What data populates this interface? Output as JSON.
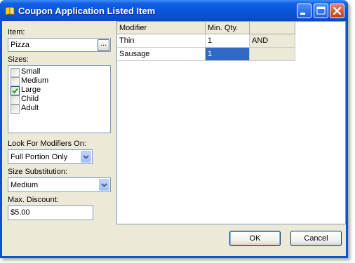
{
  "window": {
    "title": "Coupon Application Listed Item"
  },
  "titlebar_buttons": {
    "minimize": "minimize-icon",
    "maximize": "maximize-icon",
    "close": "close-icon"
  },
  "item": {
    "label": "Item:",
    "value": "Pizza",
    "browse_label": "..."
  },
  "sizes": {
    "label": "Sizes:",
    "items": [
      {
        "label": "Small",
        "checked": false
      },
      {
        "label": "Medium",
        "checked": false
      },
      {
        "label": "Large",
        "checked": true
      },
      {
        "label": "Child",
        "checked": false
      },
      {
        "label": "Adult",
        "checked": false
      }
    ]
  },
  "look_for_modifiers": {
    "label": "Look For Modifiers On:",
    "value": "Full Portion Only"
  },
  "size_substitution": {
    "label": "Size Substitution:",
    "value": "Medium"
  },
  "max_discount": {
    "label": "Max. Discount:",
    "value": "$5.00"
  },
  "grid": {
    "headers": [
      "Modifier",
      "Min. Qty.",
      ""
    ],
    "rows": [
      {
        "modifier": "Thin",
        "min_qty": "1",
        "logic": "AND"
      },
      {
        "modifier": "Sausage",
        "min_qty": "1",
        "logic": ""
      }
    ]
  },
  "buttons": {
    "ok": "OK",
    "cancel": "Cancel"
  },
  "colors": {
    "titlebar": "#0a53d8",
    "selection": "#316ac5",
    "dialog_bg": "#ece9d8",
    "check": "#21a121"
  }
}
